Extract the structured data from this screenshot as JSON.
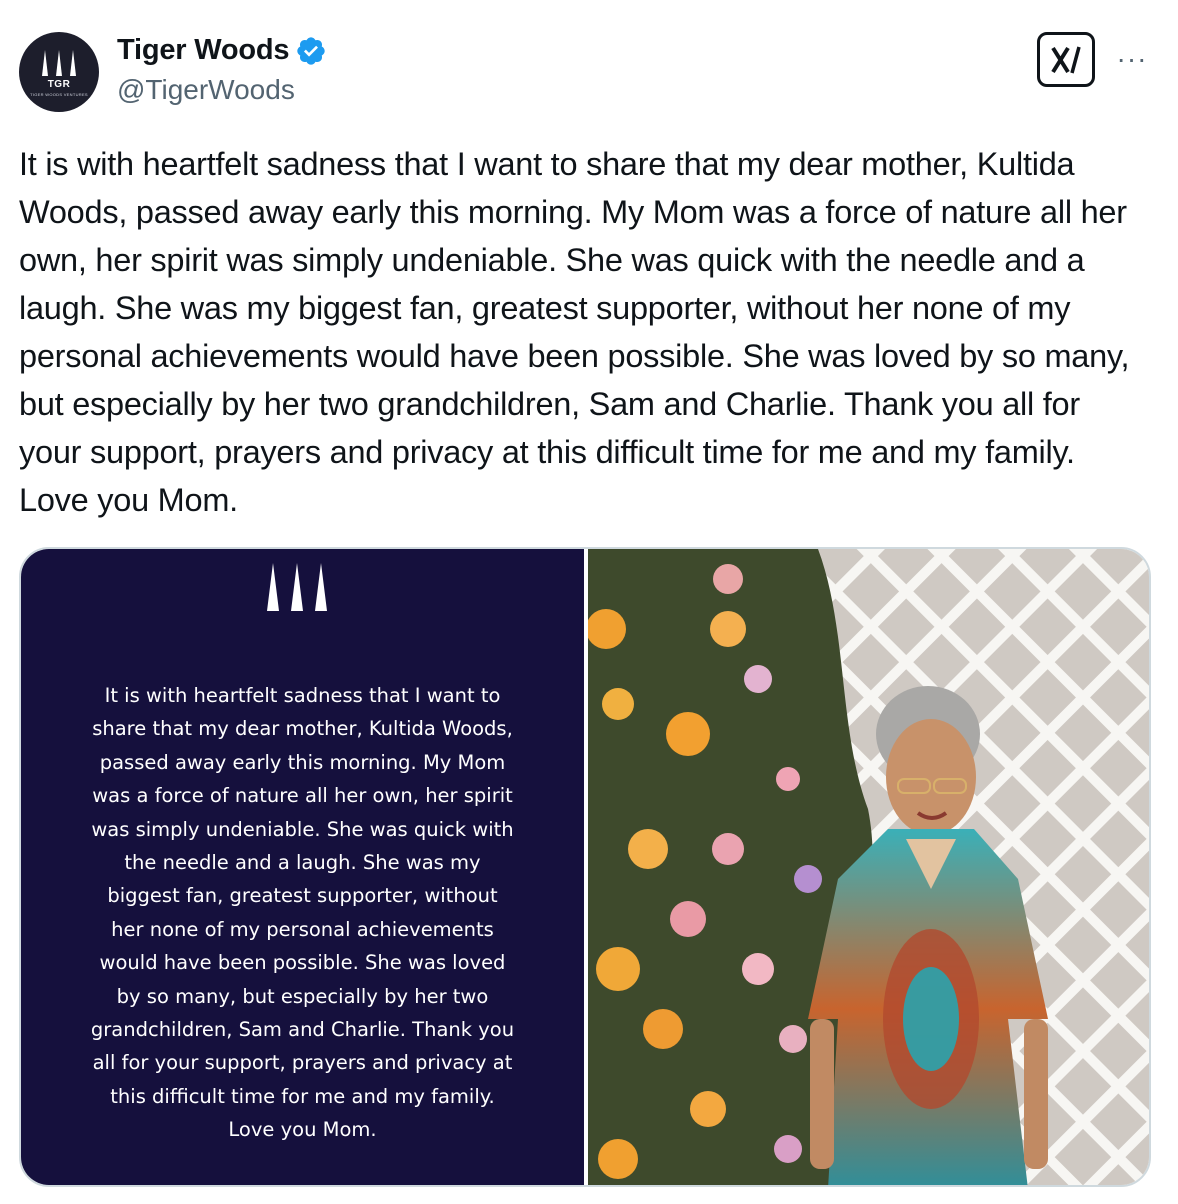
{
  "author": {
    "display_name": "Tiger Woods",
    "handle": "@TigerWoods",
    "verified": true,
    "avatar_logo_text": "TGR",
    "avatar_logo_subtext": "TIGER WOODS VENTURES"
  },
  "tweet": {
    "text": "It is with heartfelt sadness that I want to share that my dear mother, Kultida Woods, passed away early this morning. My Mom was a force of nature all her own, her spirit was simply undeniable. She was quick with the needle and a laugh. She was my biggest fan, greatest supporter, without her none of my personal achievements would have been possible. She was loved by so many,  but especially by her two grandchildren, Sam and Charlie. Thank you all for your support, prayers and privacy at this difficult time for me and my family. Love you Mom."
  },
  "media": {
    "statement_text": "It is with heartfelt sadness that I want to\nshare that my dear mother, Kultida Woods,\npassed away early this morning. My Mom\nwas a force of nature all her own, her spirit\nwas simply undeniable. She was quick with\nthe needle and a laugh. She was my\nbiggest fan, greatest supporter, without\nher none of my personal achievements\nwould have been possible. She was loved\nby so many, but especially by her two\ngrandchildren, Sam and Charlie. Thank you\nall for your support, prayers and privacy at\nthis difficult time for me and my family.\nLove you Mom."
  },
  "icons": {
    "verified": "verified-badge-icon",
    "grok": "grok-icon",
    "more": "more-options-icon",
    "logo": "tgr-logo-icon"
  },
  "colors": {
    "verified_blue": "#1d9bf0",
    "statement_bg": "#15103d",
    "secondary_text": "#536471",
    "border": "#cfd9de"
  },
  "more_label": "···"
}
